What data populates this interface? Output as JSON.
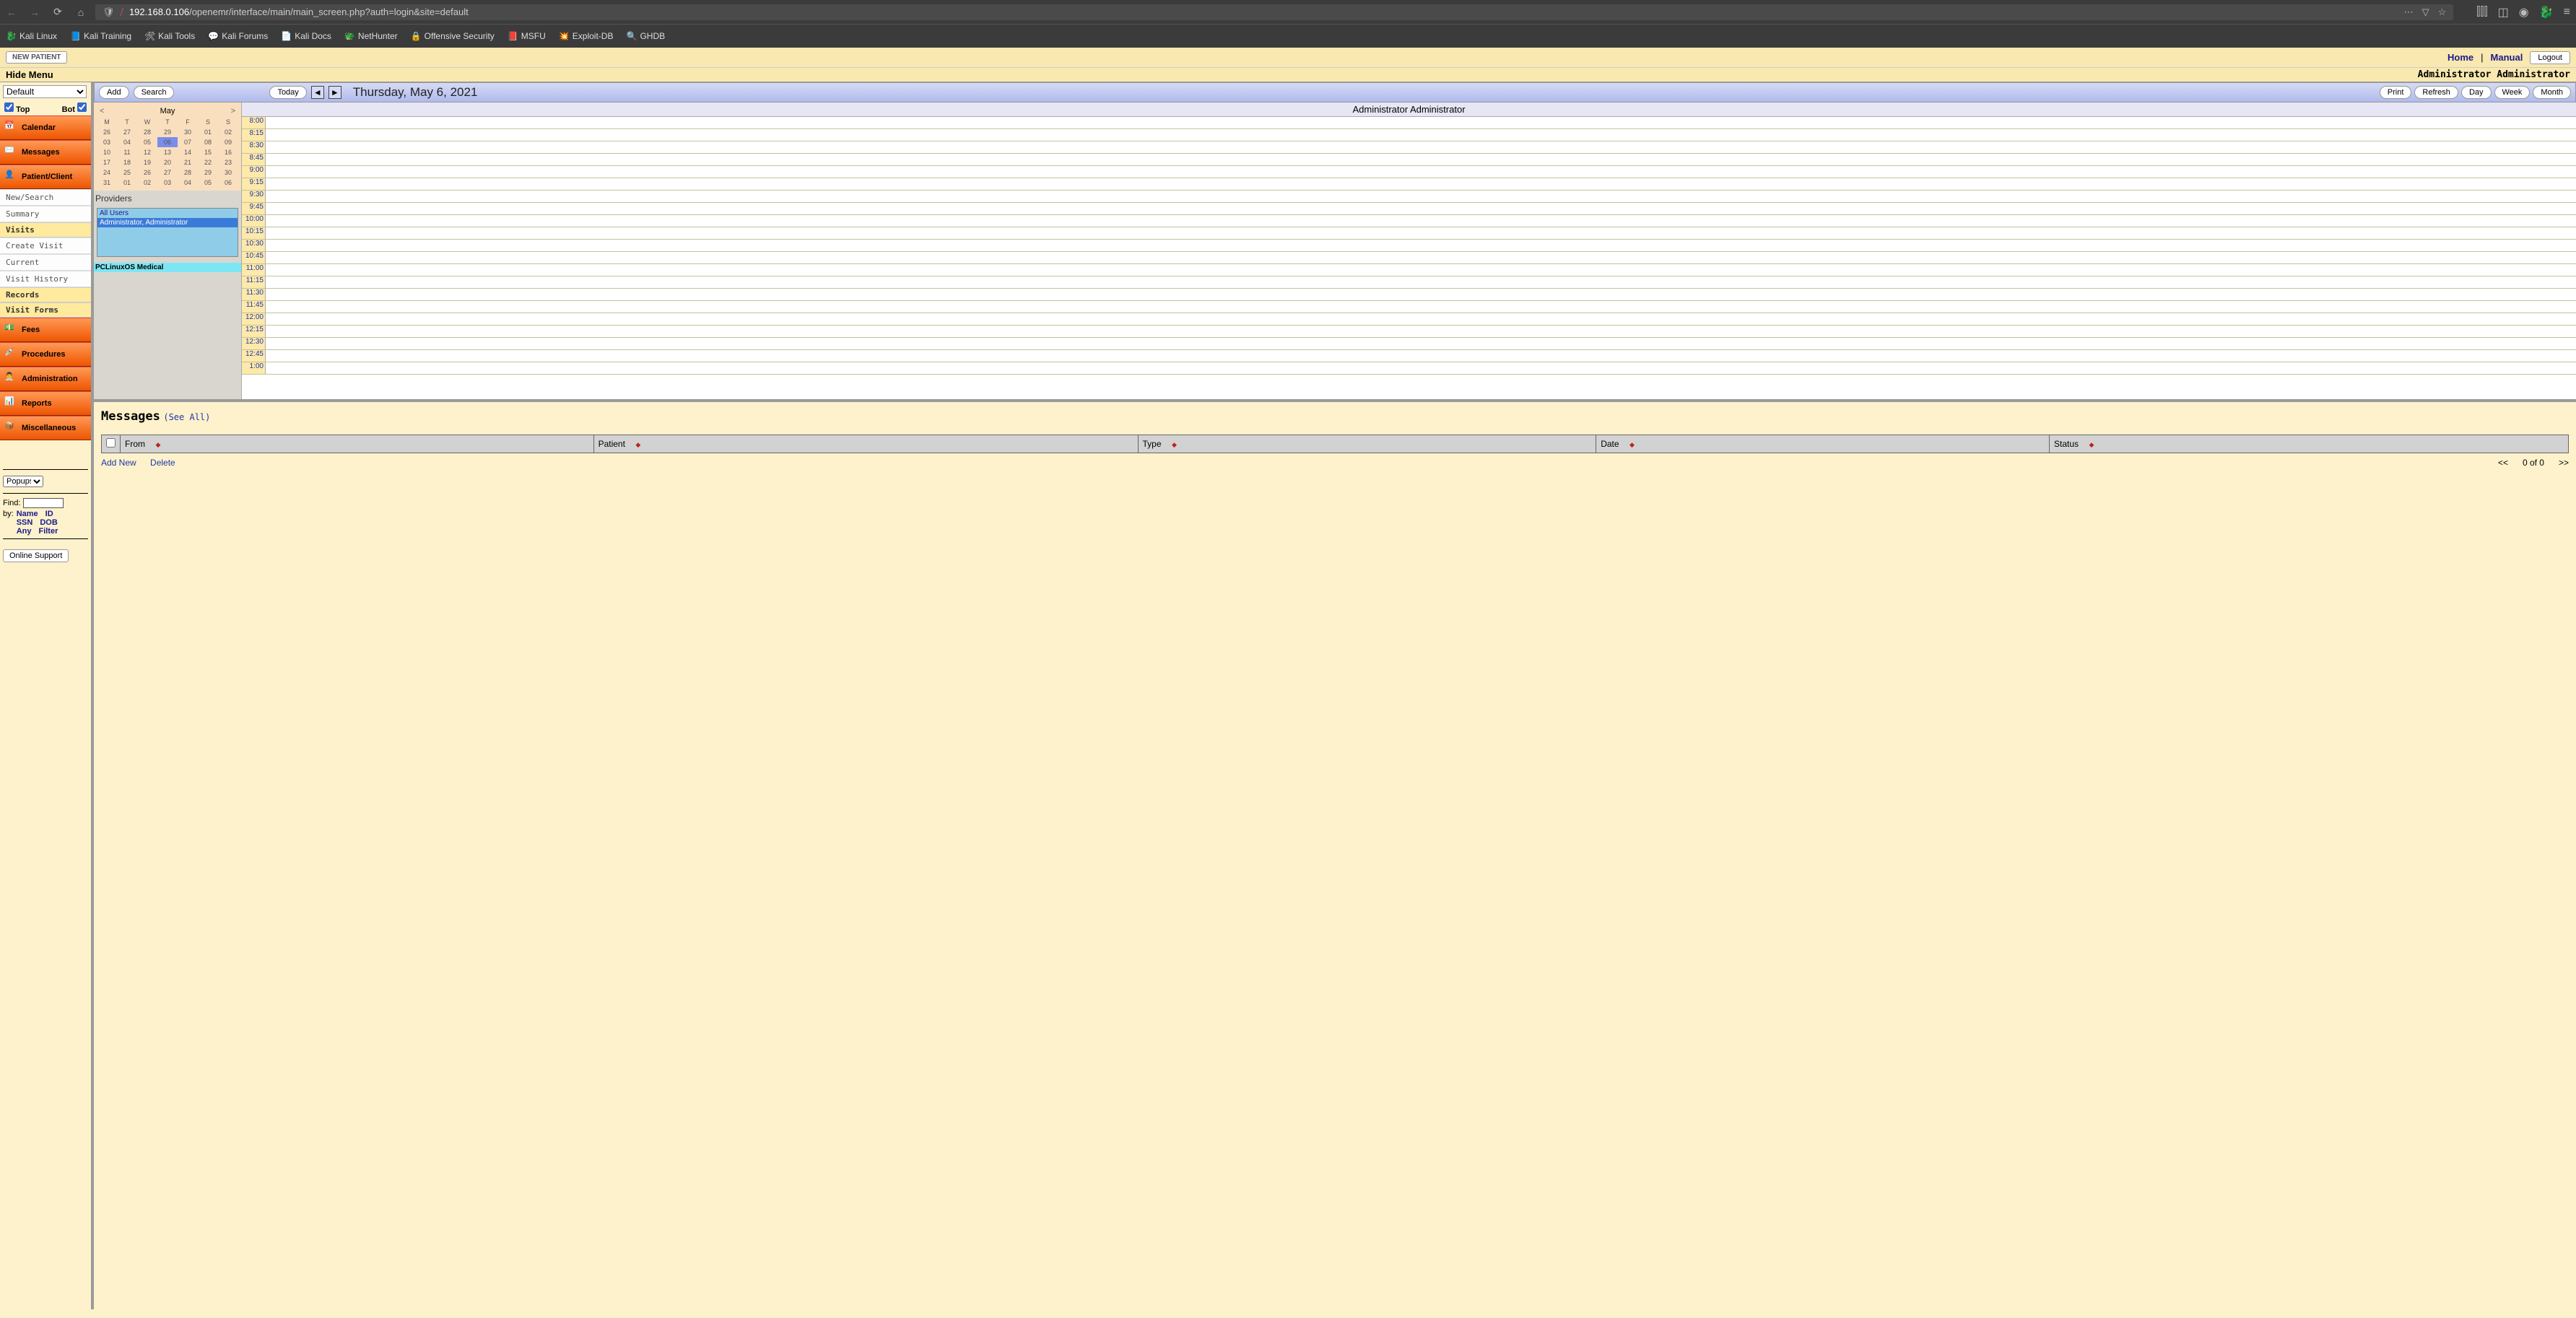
{
  "browser": {
    "url_prefix": "192.168.0.106",
    "url_path": "/openemr/interface/main/main_screen.php?auth=login&site=default",
    "bookmarks": [
      "Kali Linux",
      "Kali Training",
      "Kali Tools",
      "Kali Forums",
      "Kali Docs",
      "NetHunter",
      "Offensive Security",
      "MSFU",
      "Exploit-DB",
      "GHDB"
    ]
  },
  "topbar": {
    "new_patient": "NEW PATIENT",
    "home": "Home",
    "manual": "Manual",
    "logout": "Logout",
    "hide_menu": "Hide Menu",
    "user": "Administrator Administrator"
  },
  "sidebar": {
    "default_option": "Default",
    "top": "Top",
    "bot": "Bot",
    "menu": {
      "calendar": "Calendar",
      "messages": "Messages",
      "patient": "Patient/Client",
      "new_search": "New/Search",
      "summary": "Summary",
      "visits": "Visits",
      "create_visit": "Create Visit",
      "current": "Current",
      "visit_history": "Visit History",
      "records": "Records",
      "visit_forms": "Visit Forms",
      "fees": "Fees",
      "procedures": "Procedures",
      "administration": "Administration",
      "reports": "Reports",
      "miscellaneous": "Miscellaneous"
    },
    "popups": "Popups",
    "find": "Find:",
    "by": "by:",
    "filters": [
      "Name",
      "ID",
      "SSN",
      "DOB",
      "Any",
      "Filter"
    ],
    "online_support": "Online Support"
  },
  "calendar": {
    "add": "Add",
    "search": "Search",
    "today": "Today",
    "date_title": "Thursday, May 6, 2021",
    "print": "Print",
    "refresh": "Refresh",
    "day": "Day",
    "week": "Week",
    "month": "Month",
    "mini": {
      "month": "May",
      "dows": [
        "M",
        "T",
        "W",
        "T",
        "F",
        "S",
        "S"
      ],
      "rows": [
        [
          "26",
          "27",
          "28",
          "29",
          "30",
          "01",
          "02"
        ],
        [
          "03",
          "04",
          "05",
          "06",
          "07",
          "08",
          "09"
        ],
        [
          "10",
          "11",
          "12",
          "13",
          "14",
          "15",
          "16"
        ],
        [
          "17",
          "18",
          "19",
          "20",
          "21",
          "22",
          "23"
        ],
        [
          "24",
          "25",
          "26",
          "27",
          "28",
          "29",
          "30"
        ],
        [
          "31",
          "01",
          "02",
          "03",
          "04",
          "05",
          "06"
        ]
      ],
      "today": "06"
    },
    "providers_label": "Providers",
    "providers": {
      "all": "All Users",
      "selected": "Administrator, Administrator"
    },
    "pclinux": "PCLinuxOS Medical",
    "header_name": "Administrator Administrator",
    "times": [
      "8:00",
      "8:15",
      "8:30",
      "8:45",
      "9:00",
      "9:15",
      "9:30",
      "9:45",
      "10:00",
      "10:15",
      "10:30",
      "10:45",
      "11:00",
      "11:15",
      "11:30",
      "11:45",
      "12:00",
      "12:15",
      "12:30",
      "12:45",
      "1:00"
    ]
  },
  "messages": {
    "title": "Messages",
    "see_all": "(See All)",
    "cols": [
      "From",
      "Patient",
      "Type",
      "Date",
      "Status"
    ],
    "add_new": "Add New",
    "delete": "Delete",
    "pager": "0 of 0"
  }
}
